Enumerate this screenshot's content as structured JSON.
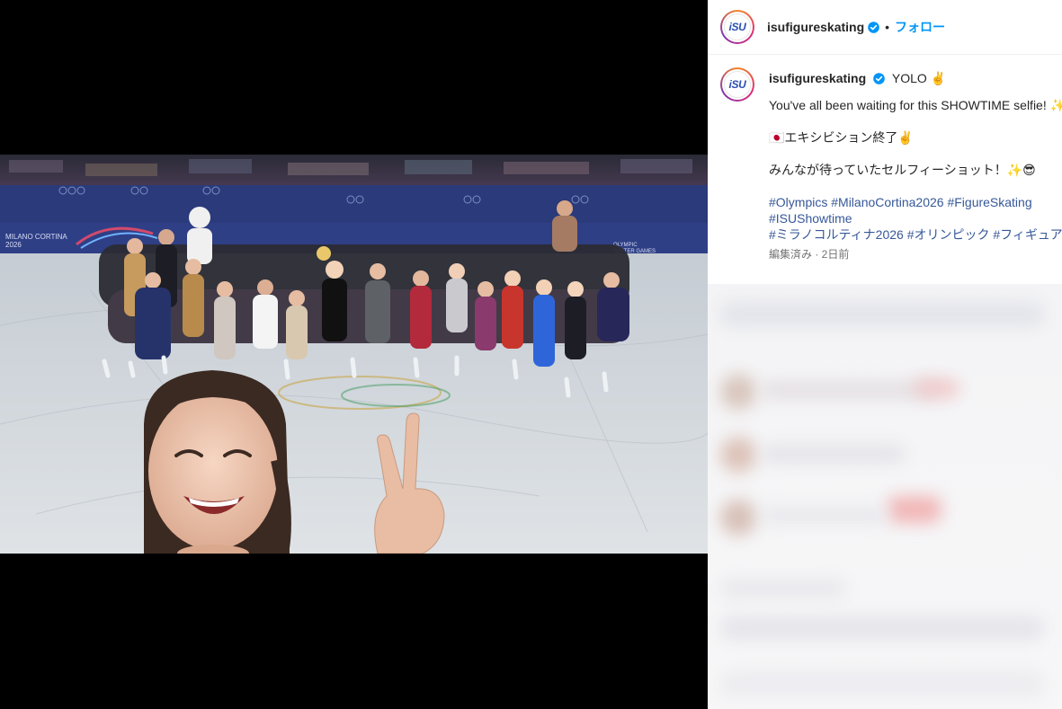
{
  "post": {
    "author": "isufigureskating",
    "avatar_text": "iSU",
    "follow_label": "フォロー",
    "separator": "•",
    "caption_title": "YOLO ✌️",
    "lines": [
      "You've all been waiting for this SHOWTIME selfie! ✨",
      "🇯🇵エキシビション終了✌️",
      "みんなが待っていたセルフィーショット！✨😎"
    ],
    "hashtags": [
      [
        "#Olympics",
        "#MilanoCortina2026",
        "#FigureSkating"
      ],
      [
        "#ISUShowtime"
      ],
      [
        "#ミラノコルティナ2026",
        "#オリンピック",
        "#フィギュア"
      ]
    ],
    "meta": "編集済み · 2日前"
  },
  "photo": {
    "banner_left": "MILANO CORTINA\n2026",
    "banner_right": "OLYMPIC\nWINTER GAMES"
  },
  "icons": {
    "user_tag": "person-icon",
    "verified": "verified-badge-icon"
  },
  "colors": {
    "verified": "#0095f6",
    "follow": "#0095f6",
    "hashtag": "#365899",
    "meta": "#737373",
    "brand": "#2a4fb5"
  }
}
